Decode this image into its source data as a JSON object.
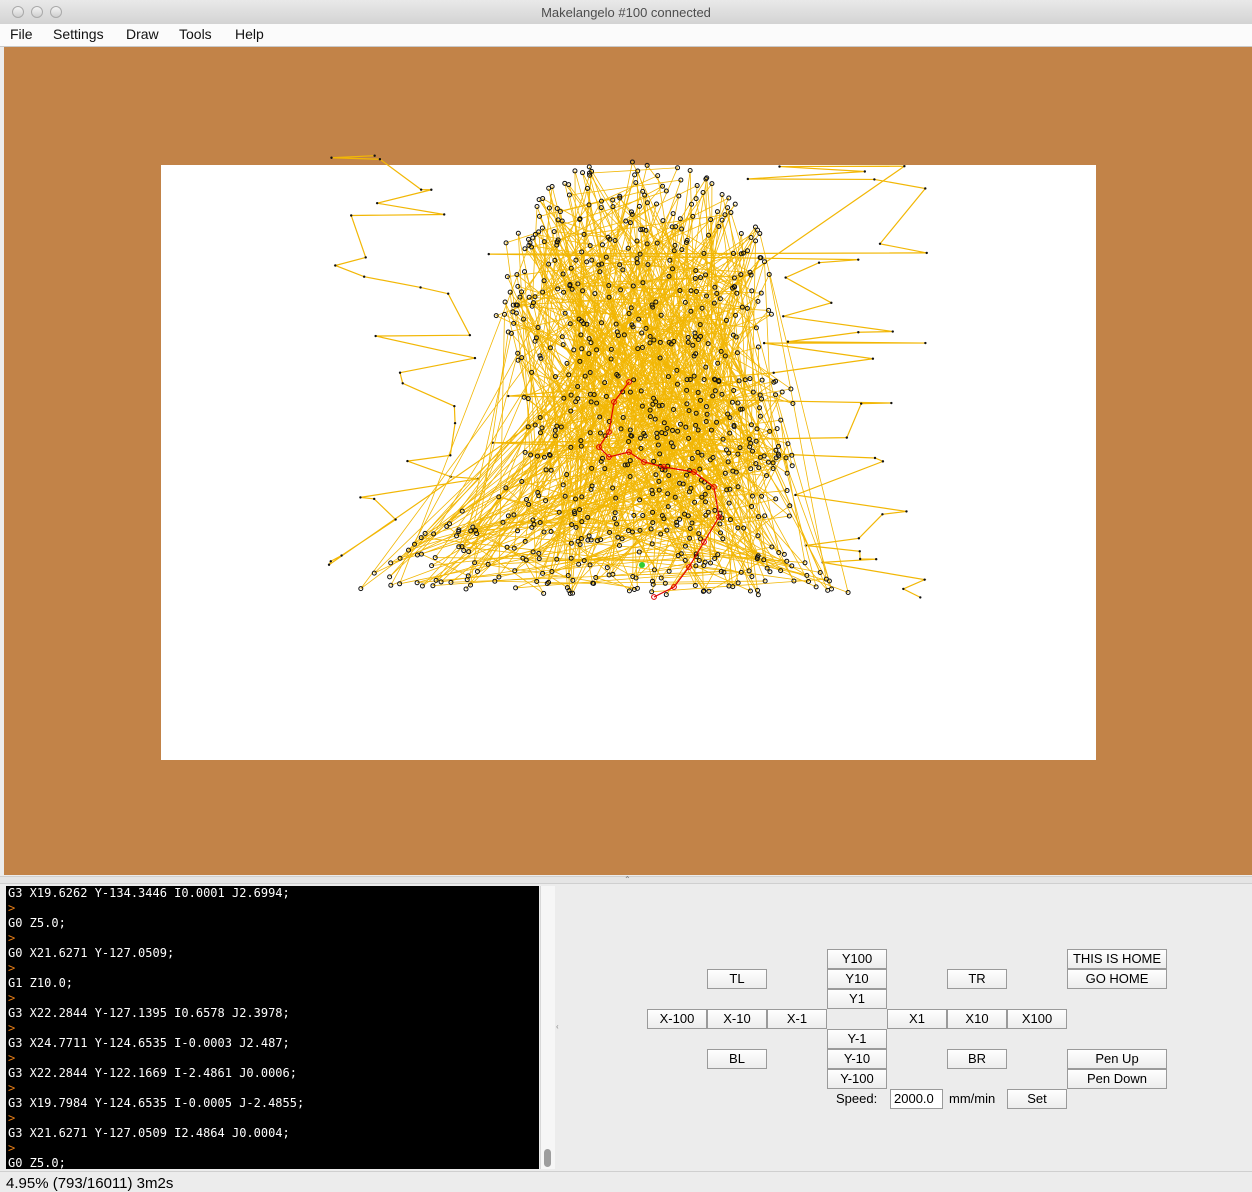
{
  "window": {
    "title": "Makelangelo #100 connected"
  },
  "menu": {
    "items": [
      "File",
      "Settings",
      "Draw",
      "Tools",
      "Help"
    ]
  },
  "colors": {
    "table": "#c28348",
    "paper": "#ffffff",
    "path_travel": "#f2b705",
    "path_active": "#e00000",
    "pen_point": "#111111",
    "pen_position": "#33cc33"
  },
  "console": {
    "lines": [
      {
        "kind": "cmd",
        "text": "G3 X19.6262 Y-134.3446 I0.0001 J2.6994;"
      },
      {
        "kind": "prompt",
        "text": ">"
      },
      {
        "kind": "cmd",
        "text": "G0 Z5.0;"
      },
      {
        "kind": "prompt",
        "text": ">"
      },
      {
        "kind": "cmd",
        "text": "G0 X21.6271 Y-127.0509;"
      },
      {
        "kind": "prompt",
        "text": ">"
      },
      {
        "kind": "cmd",
        "text": "G1 Z10.0;"
      },
      {
        "kind": "prompt",
        "text": ">"
      },
      {
        "kind": "cmd",
        "text": "G3 X22.2844 Y-127.1395 I0.6578 J2.3978;"
      },
      {
        "kind": "prompt",
        "text": ">"
      },
      {
        "kind": "cmd",
        "text": "G3 X24.7711 Y-124.6535 I-0.0003 J2.487;"
      },
      {
        "kind": "prompt",
        "text": ">"
      },
      {
        "kind": "cmd",
        "text": "G3 X22.2844 Y-122.1669 I-2.4861 J0.0006;"
      },
      {
        "kind": "prompt",
        "text": ">"
      },
      {
        "kind": "cmd",
        "text": "G3 X19.7984 Y-124.6535 I-0.0005 J-2.4855;"
      },
      {
        "kind": "prompt",
        "text": ">"
      },
      {
        "kind": "cmd",
        "text": "G3 X21.6271 Y-127.0509 I2.4864 J0.0004;"
      },
      {
        "kind": "prompt",
        "text": ">"
      },
      {
        "kind": "cmd",
        "text": "G0 Z5.0;"
      }
    ]
  },
  "controls": {
    "y100": "Y100",
    "y10": "Y10",
    "y1": "Y1",
    "ym1": "Y-1",
    "ym10": "Y-10",
    "ym100": "Y-100",
    "xm100": "X-100",
    "xm10": "X-10",
    "xm1": "X-1",
    "x1": "X1",
    "x10": "X10",
    "x100": "X100",
    "tl": "TL",
    "tr": "TR",
    "bl": "BL",
    "br": "BR",
    "this_is_home": "THIS IS HOME",
    "go_home": "GO HOME",
    "pen_up": "Pen Up",
    "pen_down": "Pen Down",
    "speed_label": "Speed:",
    "speed_value": "2000.0",
    "speed_unit": "mm/min",
    "set": "Set"
  },
  "status": {
    "text": "4.95% (793/16011) 3m2s"
  }
}
